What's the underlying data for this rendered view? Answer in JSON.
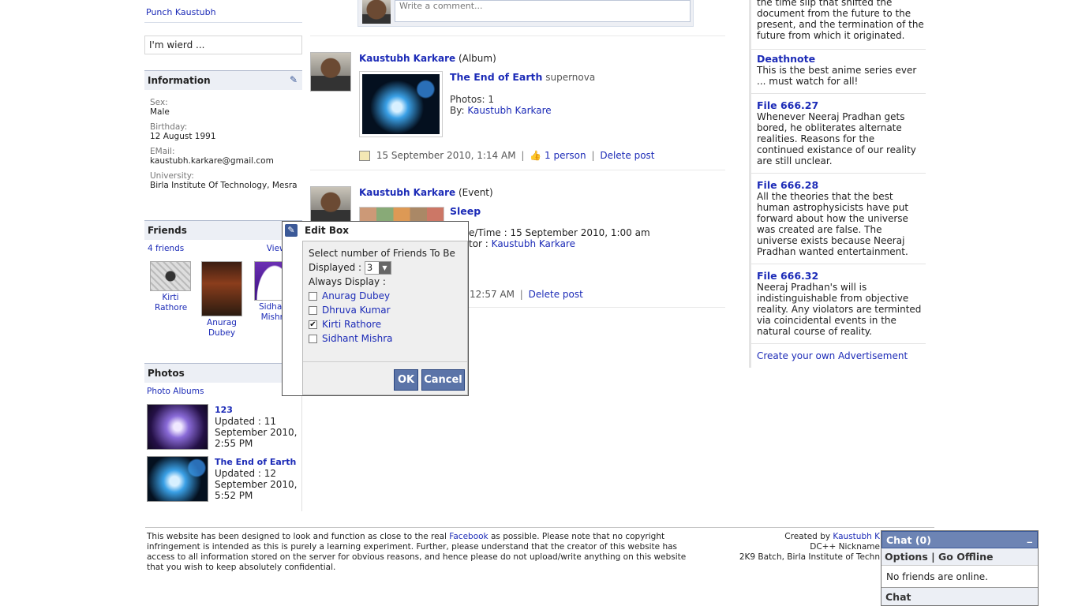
{
  "left": {
    "top_link": "Punch Kaustubh",
    "status": "I'm wierd ...",
    "information": {
      "title": "Information",
      "edit_icon": "pencil-icon",
      "fields": [
        {
          "label": "Sex:",
          "value": "Male"
        },
        {
          "label": "Birthday:",
          "value": "12 August 1991"
        },
        {
          "label": "EMail:",
          "value": "kaustubh.karkare@gmail.com"
        },
        {
          "label": "University:",
          "value": "Birla Institute Of Technology, Mesra"
        }
      ]
    },
    "friends": {
      "title": "Friends",
      "count": "4 friends",
      "view_all": "View All",
      "list": [
        {
          "name": "Kirti Rathore"
        },
        {
          "name": "Anurag Dubey"
        },
        {
          "name": "Sidhant Mishra"
        }
      ]
    },
    "photos": {
      "title": "Photos",
      "albums_link": "Photo Albums",
      "albums": [
        {
          "title": "123",
          "updated": "Updated : 11 September 2010, 2:55 PM"
        },
        {
          "title": "The End of Earth",
          "updated": "Updated : 12 September 2010, 5:52 PM"
        }
      ]
    }
  },
  "feed": {
    "comment_placeholder": "Write a comment...",
    "posts": [
      {
        "author": "Kaustubh Karkare",
        "type": "(Album)",
        "title": "The End of Earth",
        "subtitle": "supernova",
        "photos": "Photos: 1",
        "by_label": "By:",
        "by": "Kaustubh Karkare",
        "time": "15 September 2010, 1:14 AM",
        "likes": "1 person",
        "delete": "Delete post"
      },
      {
        "author": "Kaustubh Karkare",
        "type": "(Event)",
        "title": "Sleep",
        "datetime": "e/Time : 15 September 2010, 1:00 am",
        "creator_label": "tor :",
        "creator": "Kaustubh Karkare",
        "time": "12:57 AM",
        "delete": "Delete post"
      }
    ]
  },
  "edit_box": {
    "title": "Edit Box",
    "line1": "Select number of Friends To Be",
    "displayed_label": "Displayed :",
    "displayed_value": "3",
    "always_label": "Always Display :",
    "friends": [
      {
        "name": "Anurag Dubey",
        "checked": false
      },
      {
        "name": "Dhruva Kumar",
        "checked": false
      },
      {
        "name": "Kirti Rathore",
        "checked": true
      },
      {
        "name": "Sidhant Mishra",
        "checked": false
      }
    ],
    "ok": "OK",
    "cancel": "Cancel"
  },
  "ads": {
    "top_text": "the time slip that shifted the document from the future to the present, and the termination of the future from which it originated.",
    "items": [
      {
        "title": "Deathnote",
        "text": "This is the best anime series ever ... must watch for all!"
      },
      {
        "title": "File 666.27",
        "text": "Whenever Neeraj Pradhan gets bored, he obliterates alternate realities. Reasons for the continued existance of our reality are still unclear."
      },
      {
        "title": "File 666.28",
        "text": "All the theories that the best human astrophysicists have put forward about how the universe was created are false. The universe exists because Neeraj Pradhan wanted entertainment."
      },
      {
        "title": "File 666.32",
        "text": "Neeraj Pradhan's will is indistinguishable from objective reality. Any violators are terminted via coincidental events in the natural course of reality."
      }
    ],
    "create_link": "Create your own Advertisement"
  },
  "footer": {
    "text_before": "This website has been designed to look and function as close to the real",
    "facebook_link": "Facebook",
    "text_after": "as possible. Please note that no copyright infringement is intended as this is purely a learning experiment. Further, please understand that the creator of this website has access to all information stored on the server for obvious reasons, and hence please do not upload/write anything on this website that you wish to keep absolutely confidential.",
    "created_by_label": "Created by",
    "created_by": "Kaustubh K",
    "nickname": "DC++ Nickname",
    "batch": "2K9 Batch, Birla Institute of Techn"
  },
  "chat": {
    "title": "Chat (0)",
    "minimize": "_",
    "options": "Options",
    "go_offline": "Go Offline",
    "no_friends": "No friends are online.",
    "footer": "Chat"
  }
}
